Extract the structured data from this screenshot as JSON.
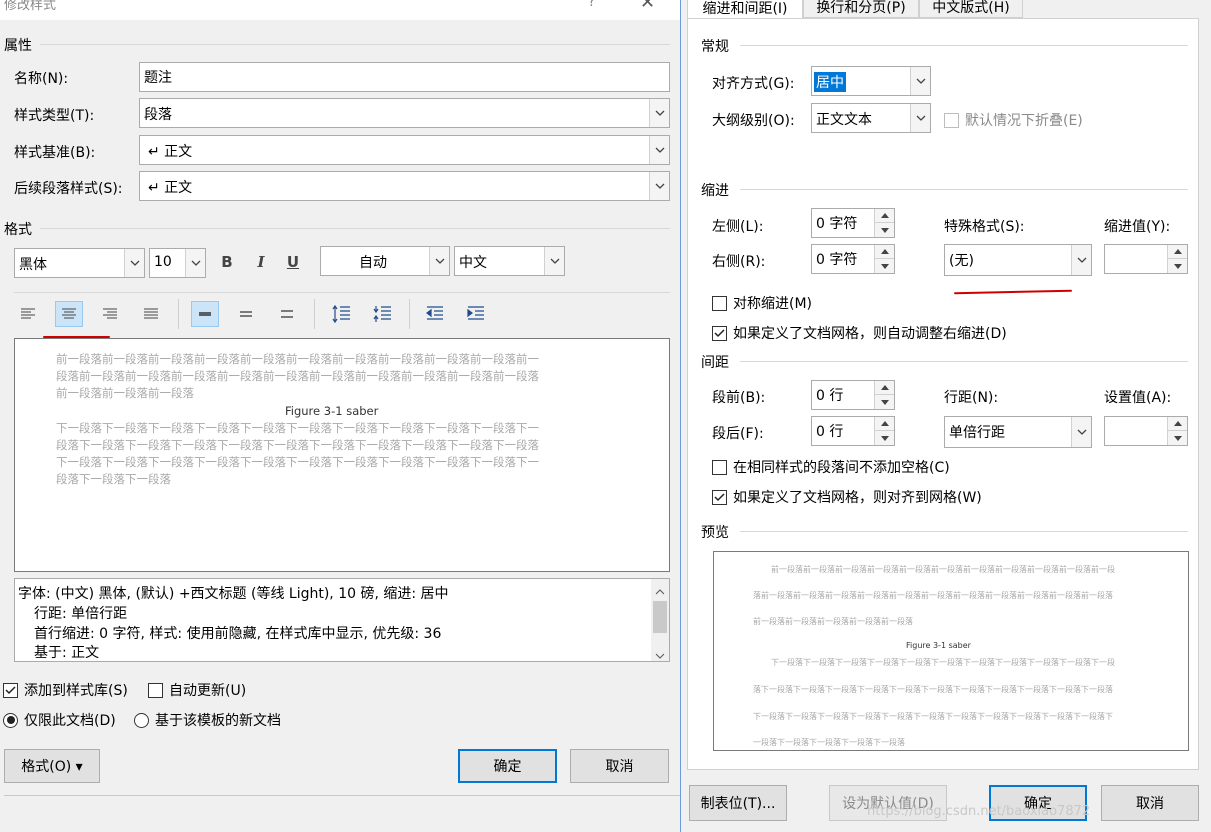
{
  "left": {
    "title": "修改样式",
    "help": "?",
    "close": "✕",
    "properties_header": "属性",
    "fields": {
      "name_label": "名称(N):",
      "name_value": "题注",
      "type_label": "样式类型(T):",
      "type_value": "段落",
      "base_label": "样式基准(B):",
      "base_value": "↵ 正文",
      "next_label": "后续段落样式(S):",
      "next_value": "↵ 正文"
    },
    "format_header": "格式",
    "font_name": "黑体",
    "font_size": "10",
    "bold": "B",
    "italic": "I",
    "underline": "U",
    "color_value": "自动",
    "lang_value": "中文",
    "preview_lines_before": [
      "前一段落前一段落前一段落前一段落前一段落前一段落前一段落前一段落前一段落前一段落前一",
      "段落前一段落前一段落前一段落前一段落前一段落前一段落前一段落前一段落前一段落前一段落",
      "前一段落前一段落前一段落"
    ],
    "preview_main": "Figure 3-1 saber",
    "preview_lines_after": [
      "下一段落下一段落下一段落下一段落下一段落下一段落下一段落下一段落下一段落下一段落下一",
      "段落下一段落下一段落下一段落下一段落下一段落下一段落下一段落下一段落下一段落下一段落",
      "下一段落下一段落下一段落下一段落下一段落下一段落下一段落下一段落下一段落下一段落下一",
      "段落下一段落下一段落"
    ],
    "description_lines": [
      "字体: (中文) 黑体, (默认) +西文标题 (等线 Light), 10 磅, 缩进: 居中",
      "行距: 单倍行距",
      "首行缩进:  0 字符, 样式: 使用前隐藏, 在样式库中显示, 优先级: 36",
      "基于: 正文"
    ],
    "add_to_gallery": "添加到样式库(S)",
    "auto_update": "自动更新(U)",
    "only_this_doc": "仅限此文档(D)",
    "new_docs_template": "基于该模板的新文档",
    "format_button": "格式(O) ▾",
    "ok": "确定",
    "cancel": "取消"
  },
  "right": {
    "tabs": [
      "缩进和间距(I)",
      "换行和分页(P)",
      "中文版式(H)"
    ],
    "general_header": "常规",
    "align_label": "对齐方式(G):",
    "align_value": "居中",
    "outline_label": "大纲级别(O):",
    "outline_value": "正文文本",
    "collapse_label": "默认情况下折叠(E)",
    "indent_header": "缩进",
    "left_label": "左侧(L):",
    "left_value": "0 字符",
    "right_label": "右侧(R):",
    "right_value": "0 字符",
    "special_label": "特殊格式(S):",
    "special_value": "(无)",
    "indent_by_label": "缩进值(Y):",
    "mirror_label": "对称缩进(M)",
    "auto_right_label": "如果定义了文档网格，则自动调整右缩进(D)",
    "spacing_header": "间距",
    "before_label": "段前(B):",
    "before_value": "0 行",
    "after_label": "段后(F):",
    "after_value": "0 行",
    "line_label": "行距(N):",
    "line_value": "单倍行距",
    "at_label": "设置值(A):",
    "no_space_label": "在相同样式的段落间不添加空格(C)",
    "snap_grid_label": "如果定义了文档网格，则对齐到网格(W)",
    "preview_header": "预览",
    "preview_before": [
      "前一段落前一段落前一段落前一段落前一段落前一段落前一段落前一段落前一段落前一段落前一段",
      "落前一段落前一段落前一段落前一段落前一段落前一段落前一段落前一段落前一段落前一段落前一段落",
      "前一段落前一段落前一段落前一段落前一段落"
    ],
    "preview_main": "Figure 3-1 saber",
    "preview_after": [
      "下一段落下一段落下一段落下一段落下一段落下一段落下一段落下一段落下一段落下一段落下一段",
      "落下一段落下一段落下一段落下一段落下一段落下一段落下一段落下一段落下一段落下一段落下一段落",
      "下一段落下一段落下一段落下一段落下一段落下一段落下一段落下一段落下一段落下一段落下一段落下",
      "一段落下一段落下一段落下一段落下一段落"
    ],
    "tabs_button": "制表位(T)...",
    "default_button": "设为默认值(D)",
    "ok": "确定",
    "cancel": "取消",
    "watermark": "https://blog.csdn.net/baoxiao7872"
  }
}
